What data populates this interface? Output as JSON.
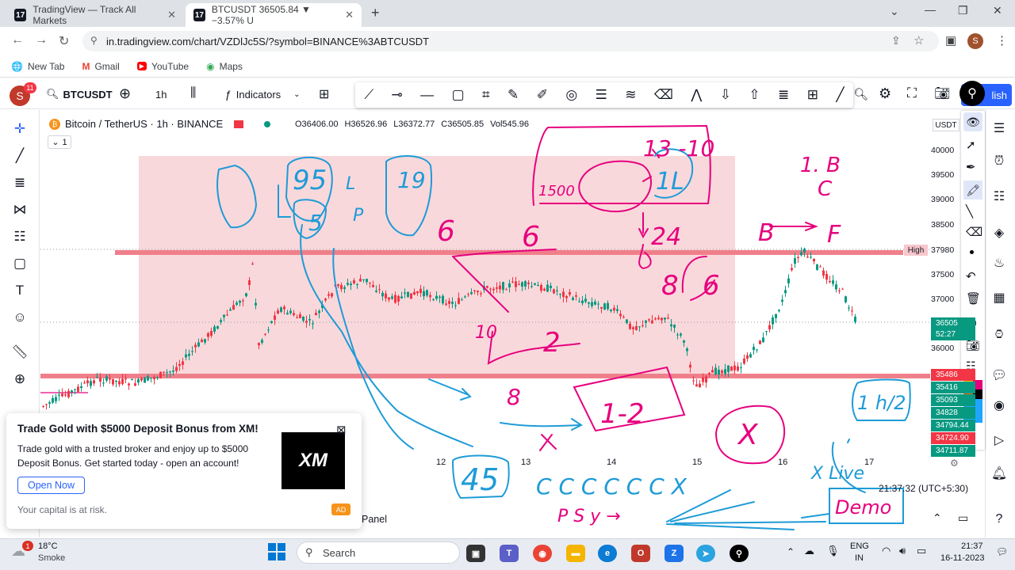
{
  "browser": {
    "tabs": [
      {
        "title": "TradingView — Track All Markets",
        "active": false
      },
      {
        "title": "BTCUSDT 36505.84 ▼ −3.57% U",
        "active": true
      }
    ],
    "url": "in.tradingview.com/chart/VZDlJc5S/?symbol=BINANCE%3ABTCUSDT",
    "bookmarks": [
      "New Tab",
      "Gmail",
      "YouTube",
      "Maps"
    ],
    "profile_initial": "S"
  },
  "toolbar": {
    "avatar_initial": "S",
    "notif_count": "11",
    "symbol": "BTCUSDT",
    "interval": "1h",
    "indicators": "Indicators",
    "publish": "lish"
  },
  "legend": {
    "title": "Bitcoin / TetherUS · 1h · BINANCE",
    "open": "O36406.00",
    "high": "H36526.96",
    "low": "L36372.77",
    "close": "C36505.85",
    "vol": "Vol545.96",
    "count": "1"
  },
  "price_scale": {
    "currency": "USDT",
    "labels": [
      "40000",
      "39500",
      "39000",
      "38500",
      "37500",
      "37000",
      "36000"
    ],
    "high_label": "High",
    "high_value": "37980",
    "current": "36505",
    "countdown": "52:27",
    "tags": [
      "35486",
      "35416",
      "35093",
      "34828",
      "34794.44",
      "34724.90",
      "34711.87"
    ]
  },
  "time_axis": {
    "labels": [
      "12",
      "13",
      "14",
      "15",
      "16",
      "17"
    ],
    "clock": "21:37:32 (UTC+5:30)",
    "panel": "Panel"
  },
  "annotations": {
    "t1": "13 -10",
    "t2": "1500",
    "t3": "1L",
    "t4": "24",
    "t5": "8",
    "t6": "6",
    "t7": "1. B",
    "t8": "C",
    "t9": "B",
    "t10": "F",
    "t11": "6",
    "t12": "10",
    "t13": "2",
    "t14": "8",
    "t15": "1-2",
    "t16": "X",
    "t17": "45",
    "t18": "C C C  C C C   X",
    "t19": "P S y  →",
    "t20": "X Live",
    "t21": "Demo",
    "t22": "1 h/2",
    "t23": "19",
    "t24": "95",
    "t25": "5",
    "t26": "L",
    "t27": "P",
    "t28": "6"
  },
  "ad": {
    "title": "Trade Gold with $5000 Deposit Bonus from XM!",
    "body": "Trade gold with a trusted broker and enjoy up to $5000 Deposit Bonus. Get started today - open an account!",
    "button": "Open Now",
    "risk": "Your capital is at risk.",
    "logo": "XM",
    "badge": "AD"
  },
  "taskbar": {
    "weather_temp": "18°C",
    "weather_desc": "Smoke",
    "weather_badge": "1",
    "search": "Search",
    "lang1": "ENG",
    "lang2": "IN",
    "time": "21:37",
    "date": "16-11-2023"
  },
  "colors": {
    "pen_pink": "#e6007e",
    "pen_cyan": "#1e9bd7",
    "zone": "#f7c7cc",
    "zone_line": "#ef7f8a",
    "candle_green": "#089981",
    "candle_red": "#f23645",
    "accent": "#2962ff"
  }
}
